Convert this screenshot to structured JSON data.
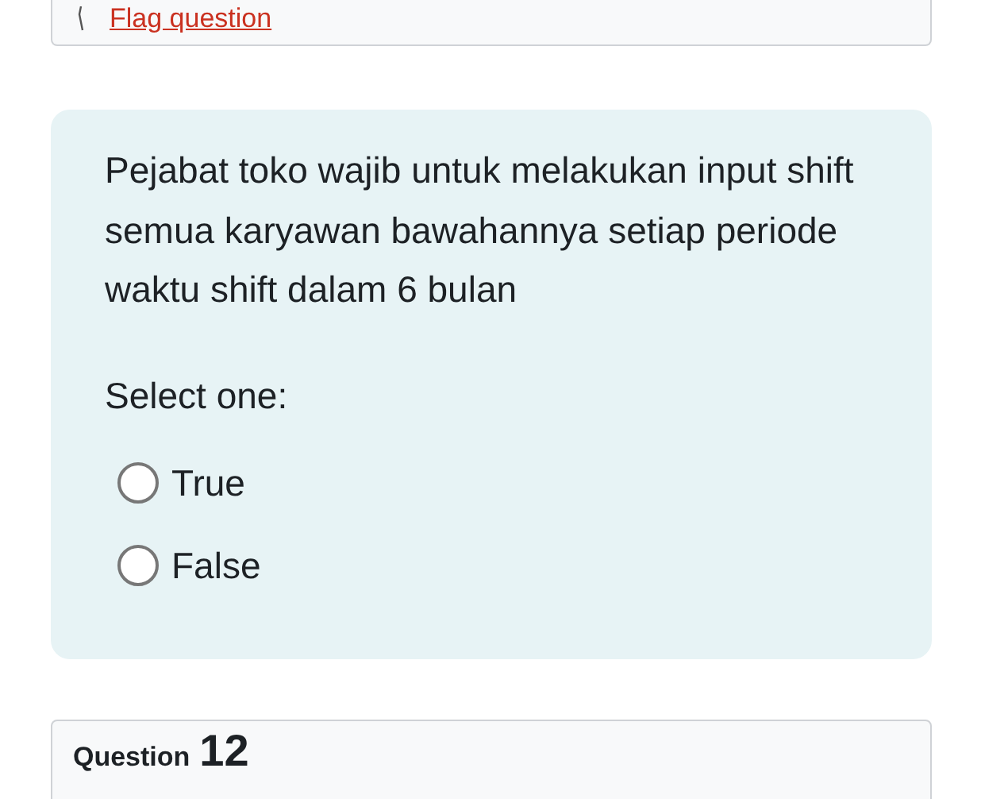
{
  "flag_link": "Flag question",
  "question": {
    "text": "Pejabat toko wajib untuk melakukan input shift semua karyawan bawahannya setiap periode waktu shift dalam 6 bulan",
    "prompt": "Select one:",
    "options": [
      {
        "label": "True",
        "selected": false
      },
      {
        "label": "False",
        "selected": false
      }
    ]
  },
  "next_question": {
    "label": "Question",
    "number": "12"
  }
}
